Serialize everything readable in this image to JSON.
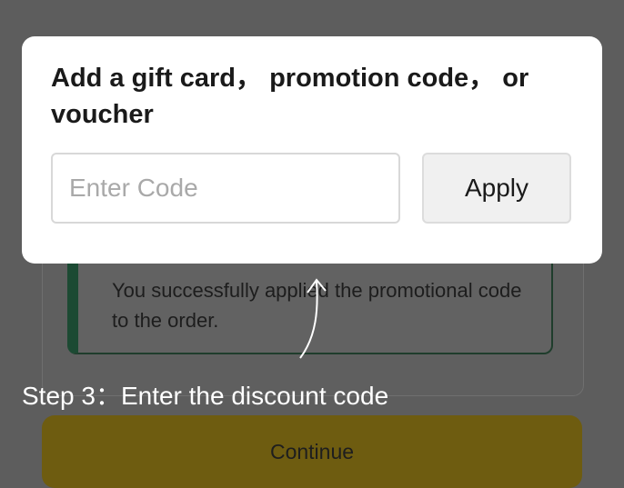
{
  "modal": {
    "title": "Add a gift card， promotion code， or voucher",
    "input_placeholder": "Enter Code",
    "input_value": "",
    "apply_label": "Apply"
  },
  "background": {
    "success_message": "You successfully applied the promotional code to the order.",
    "continue_label": "Continue"
  },
  "annotation": {
    "step_text": "Step 3：Enter the discount code"
  },
  "colors": {
    "overlay": "#5d5d5d",
    "modal_bg": "#ffffff",
    "continue_button": "#6e5c10",
    "success_accent": "#1c4a33"
  }
}
